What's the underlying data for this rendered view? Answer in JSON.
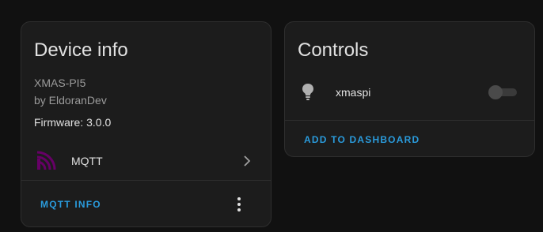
{
  "device_card": {
    "title": "Device info",
    "model": "XMAS-PI5",
    "manufacturer": "by EldoranDev",
    "firmware": "Firmware: 3.0.0",
    "integration": {
      "label": "MQTT",
      "logo_color": "#660066",
      "icon": "mqtt-logo-icon"
    },
    "action_label": "MQTT INFO",
    "overflow_icon": "dots-vertical-icon"
  },
  "controls_card": {
    "title": "Controls",
    "entities": [
      {
        "name": "xmaspi",
        "icon": "lightbulb-icon",
        "state": "off"
      }
    ],
    "action_label": "ADD TO DASHBOARD"
  },
  "colors": {
    "background": "#111111",
    "card": "#1c1c1c",
    "primary_text": "#e1e1e1",
    "secondary_text": "#9b9b9b",
    "accent": "#2a9bdc"
  }
}
